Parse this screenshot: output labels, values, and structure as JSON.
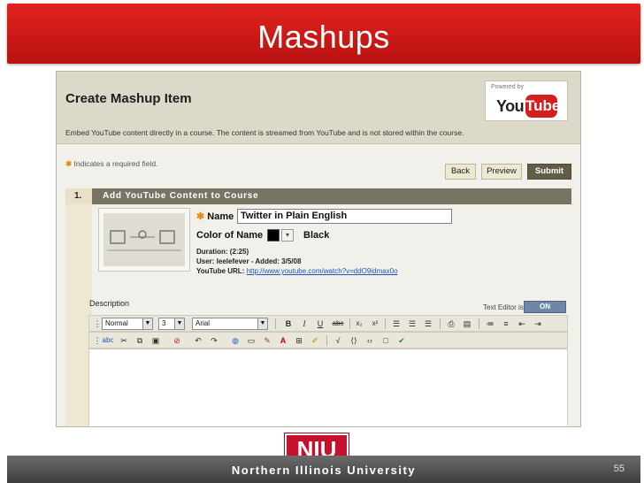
{
  "slide": {
    "title": "Mashups",
    "footer": "Northern Illinois University",
    "logo": "NIU",
    "page_number": "55",
    "header_color": "#c8161a"
  },
  "page": {
    "title": "Create Mashup Item",
    "description": "Embed YouTube content directly in a course. The content is streamed from YouTube and is not stored within the course.",
    "required_note": "Indicates a required field.",
    "powered_by": "Powered by",
    "yt_you": "You",
    "yt_tube": "Tube"
  },
  "actions": {
    "back": "Back",
    "preview": "Preview",
    "submit": "Submit"
  },
  "step": {
    "number": "1.",
    "label": "Add YouTube Content to Course"
  },
  "fields": {
    "name_label": "Name",
    "name_value": "Twitter in Plain English",
    "color_label": "Color of Name",
    "color_value": "Black",
    "duration": "Duration: (2:25)",
    "user_added": "User: leelefever - Added: 3/5/08",
    "url_label": "YouTube URL:",
    "url_value": "http://www.youtube.com/watch?v=ddO9idmax0o"
  },
  "editor": {
    "description_label": "Description",
    "text_editor_label": "Text Editor is:",
    "text_editor_state": "ON",
    "style": "Normal",
    "size": "3",
    "font": "Arial"
  }
}
